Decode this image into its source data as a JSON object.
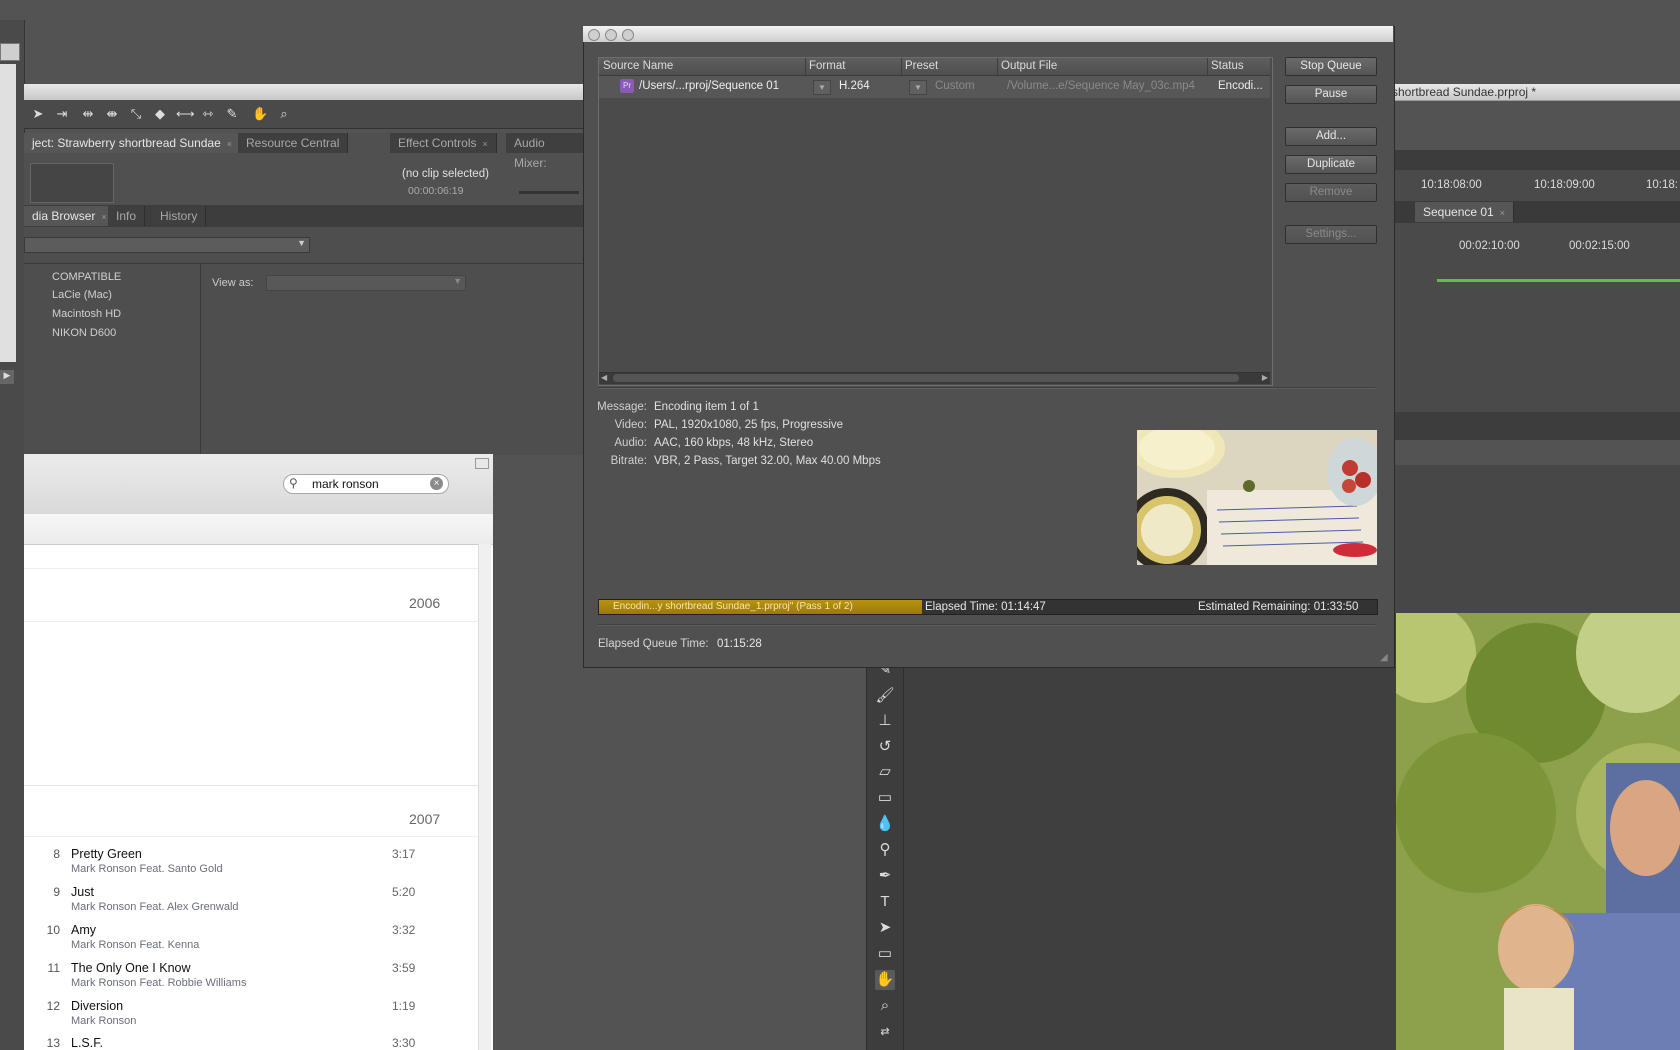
{
  "premiere": {
    "title_fragment": "shortbread Sundae.prproj *",
    "panels_top": {
      "project_tab": "ject: Strawberry shortbread Sundae",
      "resource_tab": "Resource Central",
      "effect_controls_tab": "Effect Controls",
      "audio_mixer_tab": "Audio Mixer:",
      "no_clip": "(no clip selected)",
      "timecode": "00:00:06:19"
    },
    "media_browser": {
      "tab": "dia Browser",
      "info_tab": "Info",
      "history_tab": "History",
      "drives": [
        "COMPATIBLE",
        "LaCie (Mac)",
        "Macintosh HD",
        "NIKON D600"
      ],
      "view_as_label": "View as:"
    },
    "timeline": {
      "ruler_times": [
        "10:18:08:00",
        "10:18:09:00",
        "10:18:"
      ],
      "sequence_tab": "Sequence 01",
      "seq_times": [
        "00:02:10:00",
        "00:02:15:00"
      ]
    }
  },
  "itunes": {
    "search_value": "mark ronson",
    "years": [
      "2006",
      "2007"
    ],
    "tracks": [
      {
        "num": "8",
        "title": "Pretty Green",
        "artist": "Mark Ronson Feat. Santo Gold",
        "duration": "3:17"
      },
      {
        "num": "9",
        "title": "Just",
        "artist": "Mark Ronson Feat. Alex Grenwald",
        "duration": "5:20"
      },
      {
        "num": "10",
        "title": "Amy",
        "artist": "Mark Ronson Feat. Kenna",
        "duration": "3:32"
      },
      {
        "num": "11",
        "title": "The Only One I Know",
        "artist": "Mark Ronson Feat. Robbie Williams",
        "duration": "3:59"
      },
      {
        "num": "12",
        "title": "Diversion",
        "artist": "Mark Ronson",
        "duration": "1:19"
      },
      {
        "num": "13",
        "title": "L.S.F.",
        "artist": "",
        "duration": "3:30"
      }
    ]
  },
  "encoder": {
    "columns": [
      "Source Name",
      "Format",
      "Preset",
      "Output File",
      "Status"
    ],
    "queue_item": {
      "source": "/Users/...rproj/Sequence 01",
      "format": "H.264",
      "preset": "Custom",
      "output": "/Volume...e/Sequence May_03c.mp4",
      "status": "Encodi..."
    },
    "buttons": {
      "stop_queue": "Stop Queue",
      "pause": "Pause",
      "add": "Add...",
      "duplicate": "Duplicate",
      "remove": "Remove",
      "settings": "Settings..."
    },
    "info": {
      "message_label": "Message:",
      "message": "Encoding item 1 of 1",
      "video_label": "Video:",
      "video": "PAL, 1920x1080, 25 fps, Progressive",
      "audio_label": "Audio:",
      "audio": "AAC, 160 kbps, 48 kHz, Stereo",
      "bitrate_label": "Bitrate:",
      "bitrate": "VBR, 2 Pass, Target 32.00, Max 40.00 Mbps"
    },
    "progress": {
      "label": "Encodin...y shortbread Sundae_1.prproj\" (Pass 1 of 2)",
      "fraction": 0.415,
      "elapsed": "Elapsed Time: 01:14:47",
      "remaining": "Estimated Remaining: 01:33:50"
    },
    "elapsed_queue_label": "Elapsed Queue Time:",
    "elapsed_queue": "01:15:28"
  },
  "colors": {
    "progress_fill": "#b8930f",
    "preset_icon": "#8a5bb5"
  }
}
